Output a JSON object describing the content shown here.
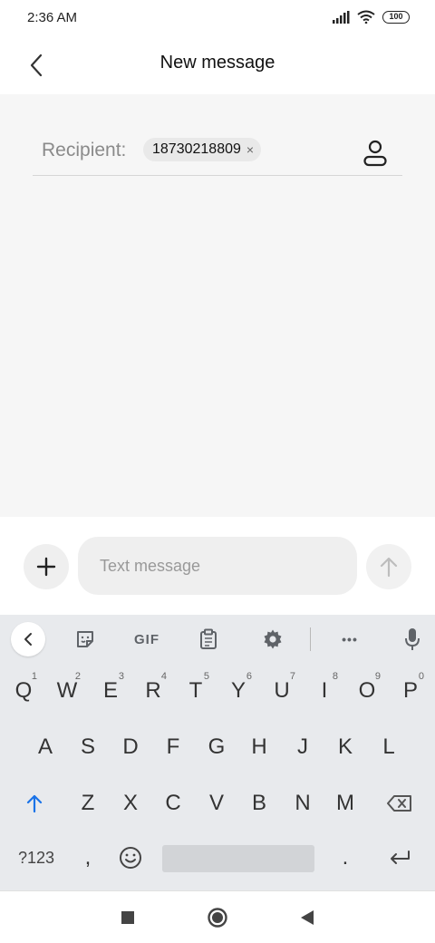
{
  "status_bar": {
    "time": "2:36 AM",
    "battery": "100",
    "icons": [
      "signal-icon",
      "wifi-icon",
      "battery-icon"
    ]
  },
  "header": {
    "title": "New message",
    "back_icon": "chevron-left-icon"
  },
  "recipient": {
    "label": "Recipient:",
    "chip_value": "18730218809",
    "chip_remove": "×",
    "contact_icon": "person-icon"
  },
  "compose": {
    "placeholder": "Text message",
    "value": "",
    "add_icon": "plus-icon",
    "send_icon": "arrow-up-icon"
  },
  "keyboard": {
    "toolbar": {
      "gif_label": "GIF",
      "more_label": "•••"
    },
    "rows": [
      [
        {
          "label": "Q",
          "hint": "1"
        },
        {
          "label": "W",
          "hint": "2"
        },
        {
          "label": "E",
          "hint": "3"
        },
        {
          "label": "R",
          "hint": "4"
        },
        {
          "label": "T",
          "hint": "5"
        },
        {
          "label": "Y",
          "hint": "6"
        },
        {
          "label": "U",
          "hint": "7"
        },
        {
          "label": "I",
          "hint": "8"
        },
        {
          "label": "O",
          "hint": "9"
        },
        {
          "label": "P",
          "hint": "0"
        }
      ],
      [
        {
          "label": "A"
        },
        {
          "label": "S"
        },
        {
          "label": "D"
        },
        {
          "label": "F"
        },
        {
          "label": "G"
        },
        {
          "label": "H"
        },
        {
          "label": "J"
        },
        {
          "label": "K"
        },
        {
          "label": "L"
        }
      ],
      [
        {
          "label": "Z"
        },
        {
          "label": "X"
        },
        {
          "label": "C"
        },
        {
          "label": "V"
        },
        {
          "label": "B"
        },
        {
          "label": "N"
        },
        {
          "label": "M"
        }
      ]
    ],
    "bottom": {
      "symbols_label": "?123",
      "comma_label": ",",
      "period_label": "."
    },
    "colors": {
      "shift_accent": "#1a73e8"
    }
  }
}
